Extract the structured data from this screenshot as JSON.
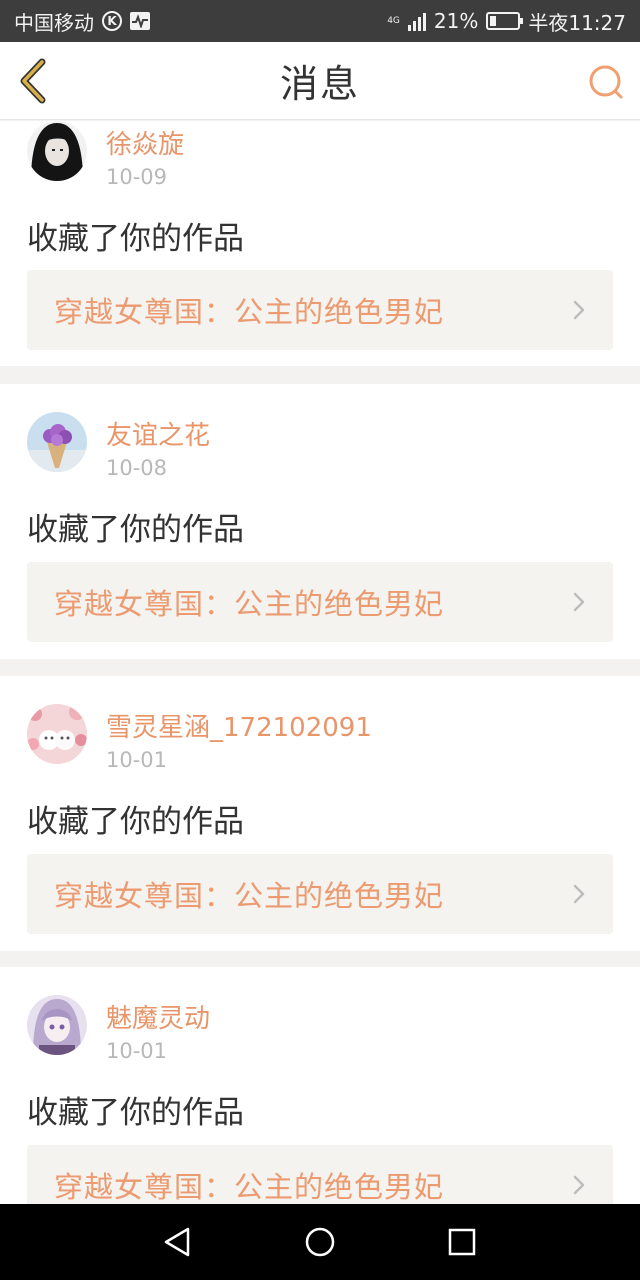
{
  "status_bar": {
    "carrier": "中国移动",
    "k_badge": "K",
    "network": "4G",
    "battery": "21%",
    "time": "半夜11:27"
  },
  "nav": {
    "title": "消息",
    "back_icon": "back-chevron-icon",
    "search_icon": "search-icon"
  },
  "messages": [
    {
      "user": "徐焱旋",
      "date": "10-09",
      "action": "收藏了你的作品",
      "work": "穿越女尊国：公主的绝色男妃",
      "avatar": "dark-hair-portrait"
    },
    {
      "user": "友谊之花",
      "date": "10-08",
      "action": "收藏了你的作品",
      "work": "穿越女尊国：公主的绝色男妃",
      "avatar": "purple-flower-cone"
    },
    {
      "user": "雪灵星涵_172102091",
      "date": "10-01",
      "action": "收藏了你的作品",
      "work": "穿越女尊国：公主的绝色男妃",
      "avatar": "white-kittens-flowers"
    },
    {
      "user": "魅魔灵动",
      "date": "10-01",
      "action": "收藏了你的作品",
      "work": "穿越女尊国：公主的绝色男妃",
      "avatar": "anime-girl-lavender"
    }
  ],
  "colors": {
    "accent": "#e8956a",
    "work_text": "#ec9a70",
    "work_bg": "#f5f3ef",
    "page_bg": "#f4f2f1"
  }
}
